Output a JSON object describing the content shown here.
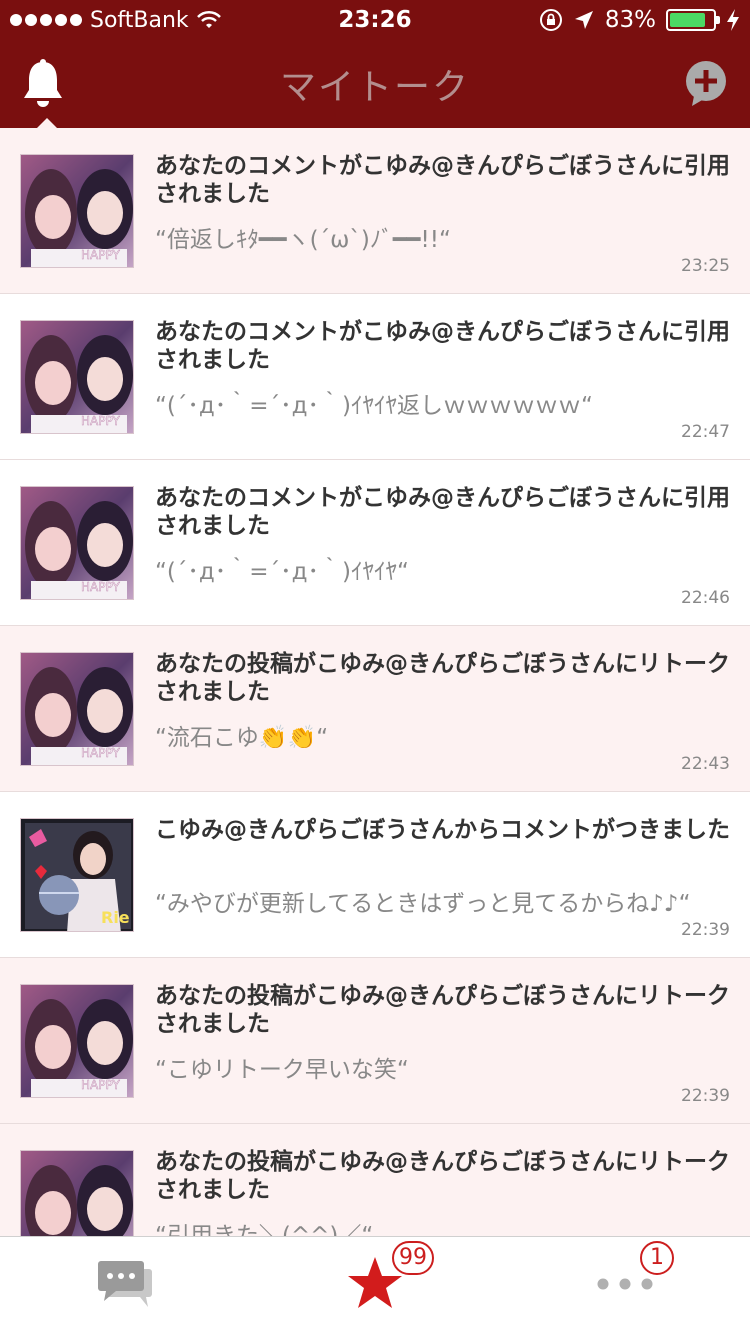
{
  "status_bar": {
    "carrier": "SoftBank",
    "time": "23:26",
    "battery_percent": "83%",
    "battery_level": 0.83
  },
  "header": {
    "title": "マイトーク"
  },
  "notifications": [
    {
      "title": "あなたのコメントがこゆみ@きんぴらごぼうさんに引用されました",
      "quote": "“倍返しｷﾀ━━ヽ(´ω`)ﾉﾞ━━!!“",
      "time": "23:25",
      "avatar": "purikura-photo",
      "unread": true
    },
    {
      "title": "あなたのコメントがこゆみ@きんぴらごぼうさんに引用されました",
      "quote": "“(´･д･｀=´･д･｀)ｲﾔｲﾔ返しｗｗｗｗｗｗ“",
      "time": "22:47",
      "avatar": "purikura-photo",
      "unread": false
    },
    {
      "title": "あなたのコメントがこゆみ@きんぴらごぼうさんに引用されました",
      "quote": "“(´･д･｀=´･д･｀)ｲﾔｲﾔ“",
      "time": "22:46",
      "avatar": "purikura-photo",
      "unread": false
    },
    {
      "title": "あなたの投稿がこゆみ@きんぴらごぼうさんにリトークされました",
      "quote": "“流石こゆ👏👏“",
      "time": "22:43",
      "avatar": "purikura-photo",
      "unread": true
    },
    {
      "title": "こゆみ@きんぴらごぼうさんからコメントがつきました",
      "quote": "“みやびが更新してるときはずっと見てるからね♪♪“",
      "time": "22:39",
      "avatar": "rie-photo",
      "unread": false
    },
    {
      "title": "あなたの投稿がこゆみ@きんぴらごぼうさんにリトークされました",
      "quote": "“こゆリトーク早いな笑“",
      "time": "22:39",
      "avatar": "purikura-photo",
      "unread": true
    },
    {
      "title": "あなたの投稿がこゆみ@きんぴらごぼうさんにリトークされました",
      "quote": "“引用きた＼(^^)／“",
      "time": "",
      "avatar": "purikura-photo",
      "unread": true
    }
  ],
  "tab_bar": {
    "items": [
      {
        "icon": "chat-bubbles-icon"
      },
      {
        "icon": "star-icon",
        "badge": "99"
      },
      {
        "icon": "more-dots-icon",
        "badge": "1"
      }
    ]
  },
  "colors": {
    "header_bg": "#7a0f0f",
    "header_title": "#b38e8e",
    "unread_bg": "#fdf2f2",
    "accent_red": "#cc1e1e"
  }
}
